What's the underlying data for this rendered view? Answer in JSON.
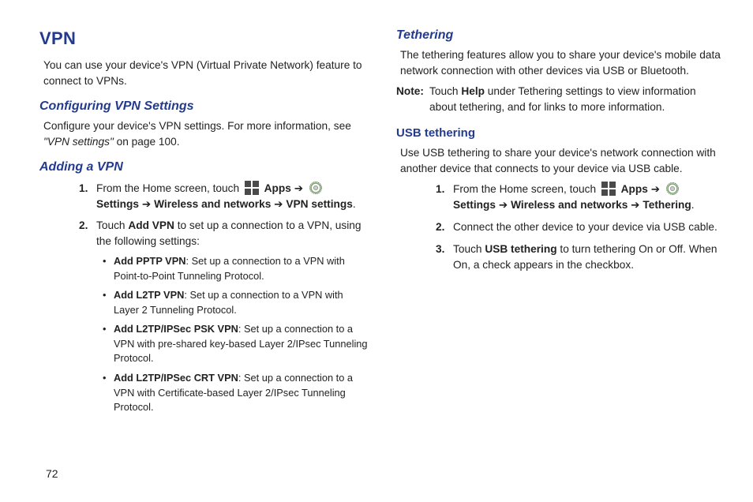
{
  "page_number": "72",
  "left": {
    "h_vpn": "VPN",
    "p_vpn_intro": "You can use your device's VPN (Virtual Private Network) feature to connect to VPNs.",
    "h_config": "Configuring VPN Settings",
    "p_config": "Configure your device's VPN settings. For more information, see ",
    "p_config_ref": "\"VPN settings\"",
    "p_config_tail": " on page 100.",
    "h_add": "Adding a VPN",
    "step1_pre": "From the Home screen, touch ",
    "apps": "Apps",
    "arrow": " ➔ ",
    "settings_lbl": "Settings",
    "wireless": "Wireless and networks",
    "vpn_settings": "VPN settings",
    "period": ".",
    "step2_a": "Touch ",
    "step2_add_vpn": "Add VPN",
    "step2_b": " to set up a connection to a VPN, using the following settings:",
    "bullets": [
      {
        "t": "Add PPTP VPN",
        "d": ": Set up a connection to a VPN with Point-to-Point Tunneling Protocol."
      },
      {
        "t": "Add L2TP VPN",
        "d": ": Set up a connection to a VPN with Layer 2 Tunneling Protocol."
      },
      {
        "t": "Add L2TP/IPSec PSK VPN",
        "d": ": Set up a connection to a VPN with pre-shared key-based Layer 2/IPsec Tunneling Protocol."
      },
      {
        "t": "Add L2TP/IPSec CRT VPN",
        "d": ": Set up a connection to a VPN with Certificate-based Layer 2/IPsec Tunneling Protocol."
      }
    ]
  },
  "right": {
    "h_teth": "Tethering",
    "p_teth": "The tethering features allow you to share your device's mobile data network connection with other devices via USB or Bluetooth.",
    "note_lbl": "Note:",
    "note_a": " Touch ",
    "note_help": "Help",
    "note_b": " under Tethering settings to view information about tethering, and for links to more information.",
    "h_usb": "USB tethering",
    "p_usb": "Use USB tethering to share your device's network connection with another device that connects to your device via USB cable.",
    "step1_pre": "From the Home screen, touch ",
    "apps": "Apps",
    "arrow": " ➔ ",
    "settings_lbl": "Settings",
    "wireless": "Wireless and networks",
    "tethering": "Tethering",
    "period": ".",
    "step2": "Connect the other device to your device via USB cable.",
    "step3_a": "Touch ",
    "step3_usb": "USB tethering",
    "step3_b": " to turn tethering On or Off. When On, a check appears in the checkbox."
  }
}
